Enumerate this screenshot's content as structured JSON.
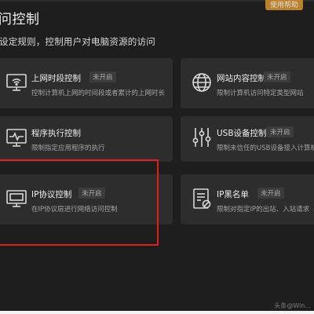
{
  "header": {
    "title": "问控制",
    "subtitle": "设定规则，控制用户对电脑资源的访问",
    "top_badge": "使用帮助"
  },
  "cards": [
    {
      "name": "上网时段控制",
      "status": "未开启",
      "desc": "控制计算机上网的时间段或者累计的上网时长",
      "icon": "monitor-wifi-icon"
    },
    {
      "name": "网站内容控制",
      "status": "未开启",
      "desc": "限制计算机访问特定类型网站",
      "icon": "globe-icon"
    },
    {
      "name": "程序执行控制",
      "status": "未开启",
      "desc": "限制指定应用程序的执行",
      "icon": "monitor-pulse-icon"
    },
    {
      "name": "USB设备控制",
      "status": "未开启",
      "desc": "限制未信任的USB设备接入计算机",
      "icon": "sliders-icon"
    },
    {
      "name": "IP协议控制",
      "status": "未开启",
      "desc": "在IP协议层进行网络访问控制",
      "icon": "monitor-screen-icon"
    },
    {
      "name": "IP黑名单",
      "status": "未开启",
      "desc": "限制对指定IP的出站、入站请求",
      "icon": "document-ban-icon"
    }
  ],
  "watermark": "头条@Win..."
}
